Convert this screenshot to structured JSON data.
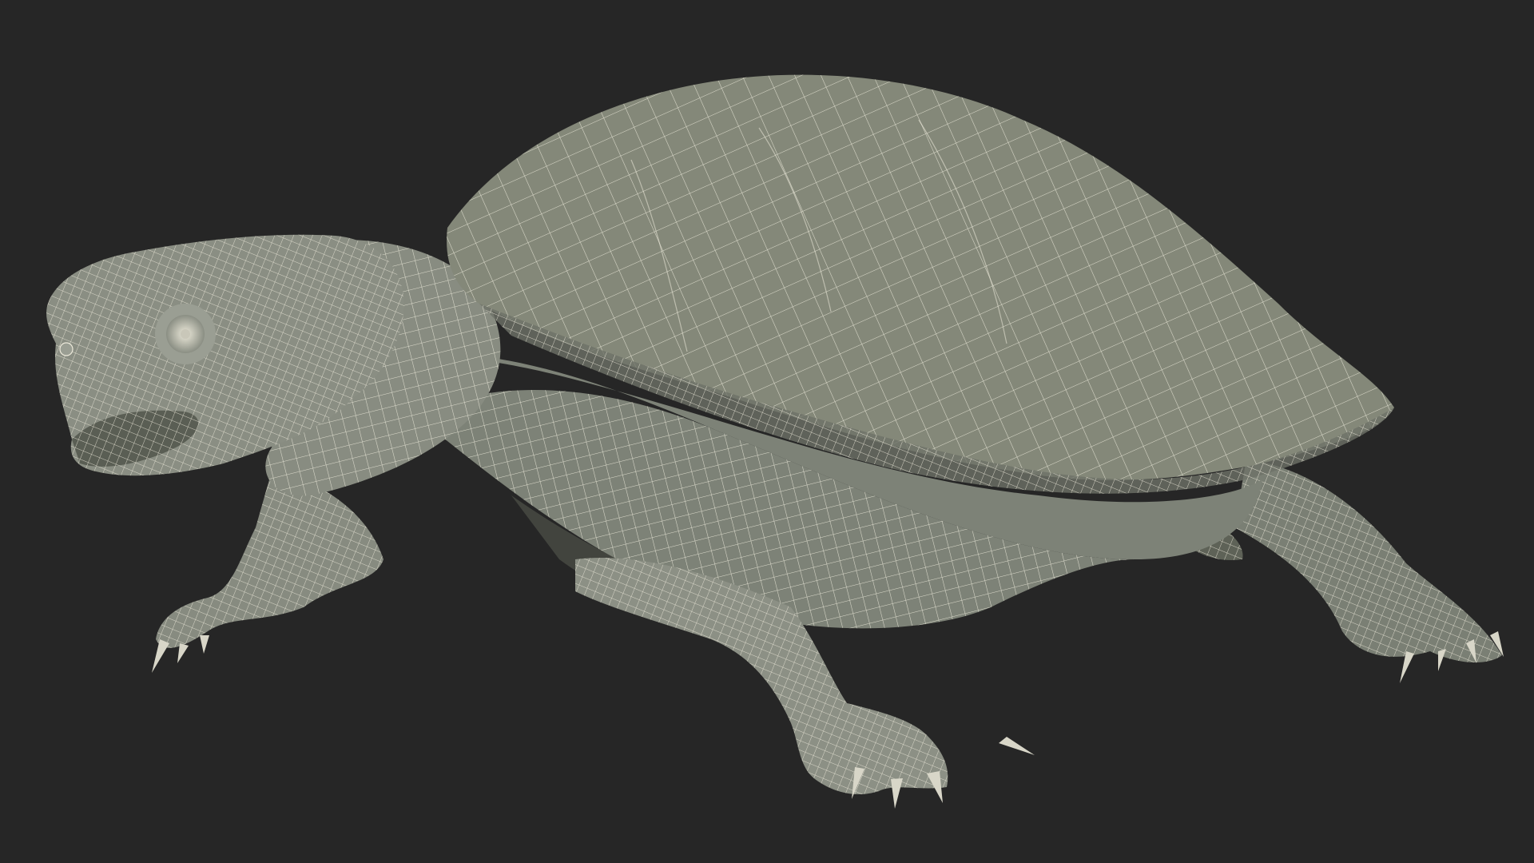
{
  "scene": {
    "subject": "turtle-wireframe-render",
    "colors": {
      "background": "#262626",
      "surface": "#80857A",
      "surface_light": "#A4A89E",
      "surface_dark": "#55594F",
      "wire": "#EDEADB"
    }
  }
}
